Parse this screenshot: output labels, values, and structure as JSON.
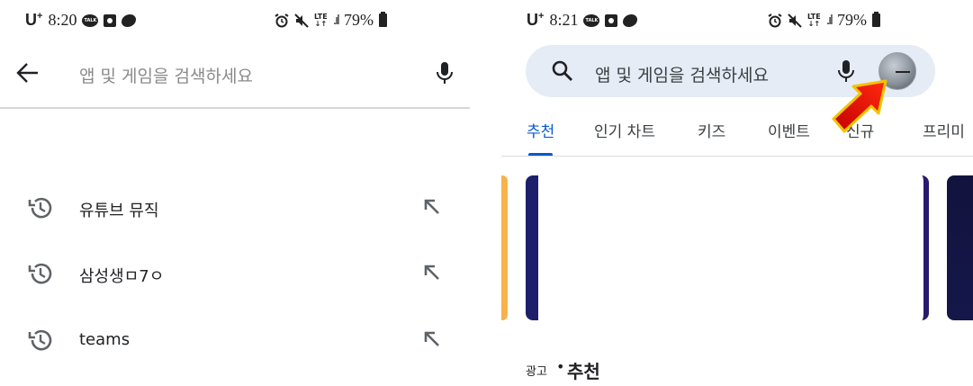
{
  "left": {
    "status": {
      "carrier": "U",
      "carrier_sup": "+",
      "time": "8:20",
      "talk": "TALK",
      "network": "LTE",
      "battery": "79%"
    },
    "search": {
      "placeholder": "앱 및 게임을 검색하세요"
    },
    "history": [
      {
        "label": "유튜브 뮤직"
      },
      {
        "label": "삼성생ㅁ7ㅇ"
      },
      {
        "label": "teams"
      }
    ]
  },
  "right": {
    "status": {
      "carrier": "U",
      "carrier_sup": "+",
      "time": "8:21",
      "talk": "TALK",
      "network": "LTE",
      "battery": "79%"
    },
    "search": {
      "placeholder": "앱 및 게임을 검색하세요"
    },
    "tabs": [
      {
        "label": "추천",
        "active": true
      },
      {
        "label": "인기 차트"
      },
      {
        "label": "키즈"
      },
      {
        "label": "이벤트"
      },
      {
        "label": "신규"
      },
      {
        "label": "프리미"
      }
    ],
    "section": {
      "ad_label": "광고",
      "separator": "•",
      "title": "추천"
    }
  },
  "icons": {
    "back": "arrow-left-icon",
    "mic": "microphone-icon",
    "search": "magnifier-icon",
    "history": "history-clock-icon",
    "fill_query": "arrow-up-left-icon",
    "annotation": "red-pointer-arrow"
  },
  "colors": {
    "accent": "#0b57d0",
    "pill": "#e6ecf5",
    "annotation_red": "#e8140a",
    "annotation_yellow": "#f5c300"
  }
}
